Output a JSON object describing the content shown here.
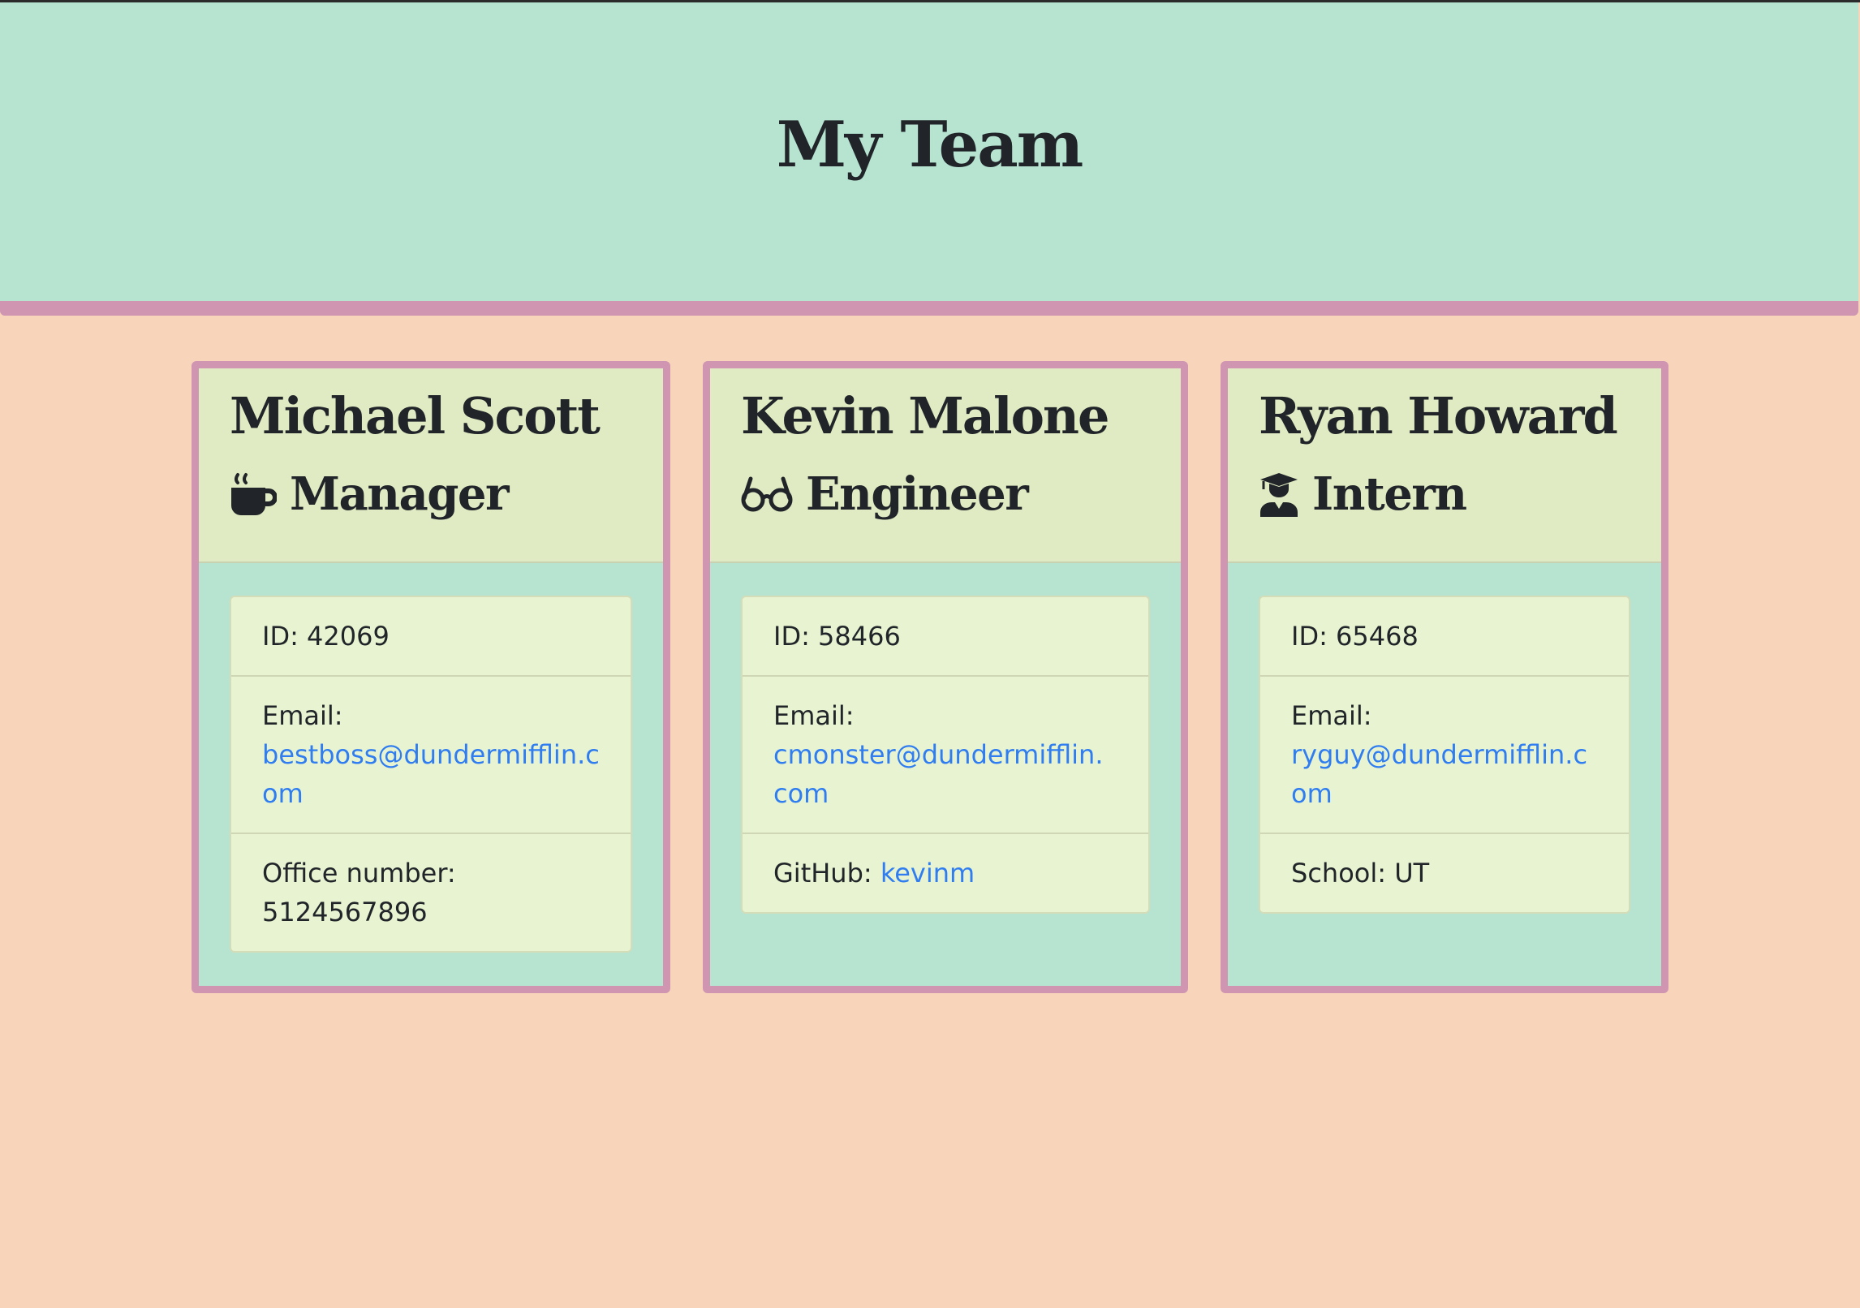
{
  "header": {
    "title": "My Team"
  },
  "cards": [
    {
      "name": "Michael Scott",
      "role": "Manager",
      "icon": "coffee-mug-icon",
      "id_text": "ID: 42069",
      "email_label": "Email:",
      "email": "bestboss@dundermifflin.com",
      "extra_label": "Office number:",
      "extra_value": "5124567896"
    },
    {
      "name": "Kevin Malone",
      "role": "Engineer",
      "icon": "glasses-icon",
      "id_text": "ID: 58466",
      "email_label": "Email:",
      "email": "cmonster@dundermifflin.com",
      "extra_label": "GitHub:",
      "extra_value": "kevinm"
    },
    {
      "name": "Ryan Howard",
      "role": "Intern",
      "icon": "graduate-icon",
      "id_text": "ID: 65468",
      "email_label": "Email:",
      "email": "ryguy@dundermifflin.com",
      "extra_label": "School:",
      "extra_value": "UT"
    }
  ],
  "colors": {
    "page_bg": "#f8d4bb",
    "header_bg": "#b6e4d1",
    "accent_border": "#d095b1",
    "card_head_bg": "#e0ebc3",
    "list_bg": "#e8f4d1",
    "link": "#2f7df0"
  }
}
